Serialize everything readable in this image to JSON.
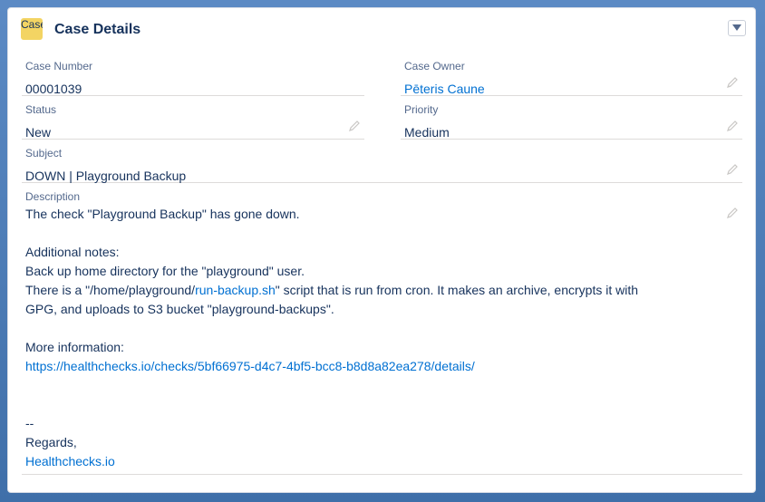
{
  "card": {
    "icon_text": "Case",
    "title": "Case Details"
  },
  "fields": {
    "case_number": {
      "label": "Case Number",
      "value": "00001039"
    },
    "case_owner": {
      "label": "Case Owner",
      "value": "Pēteris Caune"
    },
    "status": {
      "label": "Status",
      "value": "New"
    },
    "priority": {
      "label": "Priority",
      "value": "Medium"
    },
    "subject": {
      "label": "Subject",
      "value": "DOWN | Playground Backup"
    },
    "description": {
      "label": "Description",
      "line1": "The check \"Playground Backup\" has gone down.",
      "line2": "Additional notes:",
      "line3": "Back up home directory for the \"playground\" user.",
      "line4_before": "There is a \"/home/playground/",
      "line4_link": "run-backup.sh",
      "line4_after": "\" script that is run from cron. It makes an archive, encrypts it with",
      "line5": "GPG, and uploads to S3 bucket \"playground-backups\".",
      "line6": "More information:",
      "line7_link": "https://healthchecks.io/checks/5bf66975-d4c7-4bf5-bcc8-b8d8a82ea278/details/",
      "line8": "--",
      "line9": "Regards,",
      "line10_link": "Healthchecks.io"
    }
  },
  "icons": {
    "edit": "pencil-icon",
    "menu": "chevron-down-icon"
  },
  "colors": {
    "link": "#0070d2",
    "text": "#16325c",
    "label": "#54698d",
    "case_icon": "#f3d463",
    "background": "#4a7ab5"
  }
}
